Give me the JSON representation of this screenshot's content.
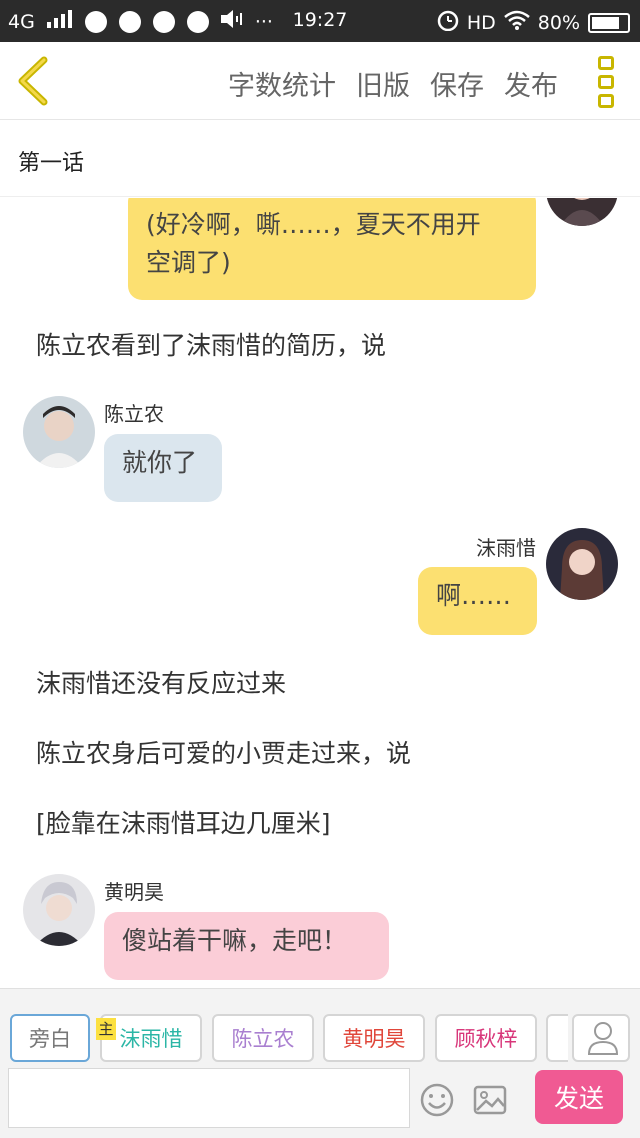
{
  "status_bar": {
    "network": "4G",
    "time": "19:27",
    "hd": "HD",
    "battery_percent": "80%",
    "battery_level": 0.8,
    "dots": "···"
  },
  "nav": {
    "actions": [
      "字数统计",
      "旧版",
      "保存",
      "发布"
    ]
  },
  "chapter_title": "第一话",
  "messages": {
    "top_bubble_line1": "(好冷啊，嘶……，夏天不用开",
    "top_bubble_line2": "空调了)",
    "narration1": "陈立农看到了沫雨惜的简历，说",
    "chen_name": "陈立农",
    "chen_text": "就你了",
    "mo_name": "沫雨惜",
    "mo_text": "啊……",
    "narration2": "沫雨惜还没有反应过来",
    "narration3": "陈立农身后可爱的小贾走过来，说",
    "narration4": "[脸靠在沫雨惜耳边几厘米]",
    "huang_name": "黄明昊",
    "huang_text": "傻站着干嘛，走吧！"
  },
  "toolbar": {
    "chips": [
      {
        "label": "旁白",
        "color": "#777777"
      },
      {
        "label": "沫雨惜",
        "color": "#2bb6a6"
      },
      {
        "label": "陈立农",
        "color": "#a97fd0"
      },
      {
        "label": "黄明昊",
        "color": "#e0463a"
      },
      {
        "label": "顾秋梓",
        "color": "#d8367a"
      }
    ],
    "main_badge": "主",
    "input_placeholder": "",
    "send_label": "发送"
  },
  "colors": {
    "accent_yellow": "#fce071",
    "send_pink": "#f05a93"
  }
}
